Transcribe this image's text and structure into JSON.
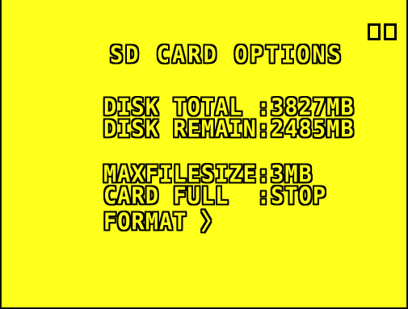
{
  "menu": {
    "title": "SD CARD OPTIONS",
    "disk_total": {
      "label": "DISK TOTAL ",
      "sep": ":",
      "value": "3827MB"
    },
    "disk_remain": {
      "label": "DISK REMAIN",
      "sep": ":",
      "value": "2485MB"
    },
    "max_file_size": {
      "label": "MAXFILESIZE",
      "sep": ":",
      "value": "3MB"
    },
    "card_full": {
      "label": "CARD FULL  ",
      "sep": ":",
      "value": "STOP"
    },
    "format": {
      "label": "FORMAT",
      "arrow": "〉"
    }
  },
  "colors": {
    "background": "#ffff1c",
    "text_outline": "#000000"
  },
  "icons": [
    "box-icon",
    "box-icon"
  ]
}
